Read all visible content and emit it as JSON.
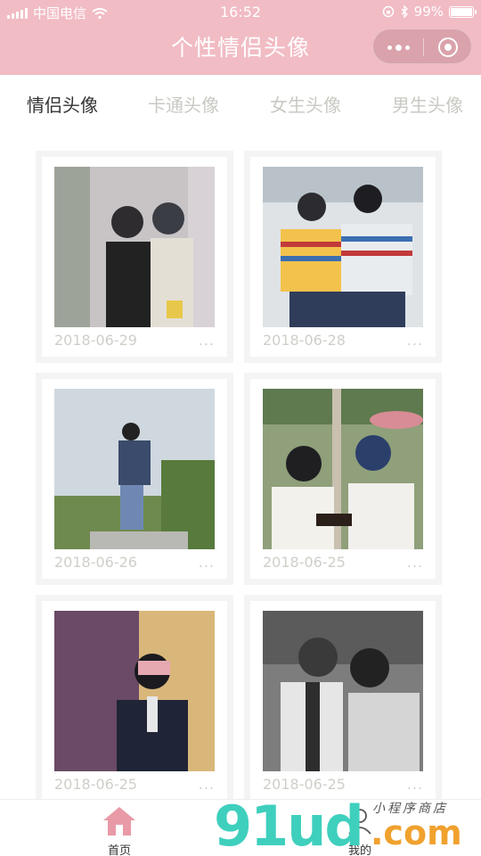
{
  "status": {
    "carrier": "中国电信",
    "time": "16:52",
    "battery": "99%",
    "battery_level": 0.99
  },
  "nav": {
    "title": "个性情侣头像"
  },
  "tabs": [
    {
      "label": "情侣头像",
      "active": true
    },
    {
      "label": "卡通头像",
      "active": false
    },
    {
      "label": "女生头像",
      "active": false
    },
    {
      "label": "男生头像",
      "active": false
    }
  ],
  "items": [
    {
      "date": "2018-06-29",
      "more": "..."
    },
    {
      "date": "2018-06-28",
      "more": "..."
    },
    {
      "date": "2018-06-26",
      "more": "..."
    },
    {
      "date": "2018-06-25",
      "more": "..."
    },
    {
      "date": "2018-06-25",
      "more": "..."
    },
    {
      "date": "2018-06-25",
      "more": "..."
    }
  ],
  "bottom_tabs": [
    {
      "label": "首页",
      "icon": "home-icon",
      "active": true
    },
    {
      "label": "我的",
      "icon": "user-icon",
      "active": false
    }
  ],
  "watermark": {
    "logo": "91ud",
    "suffix": ".com",
    "tagline": "小程序商店"
  },
  "colors": {
    "header_pink": "#f1bcc4",
    "home_icon_pink": "#e89aa6",
    "date_gray": "#cfcfc9"
  }
}
